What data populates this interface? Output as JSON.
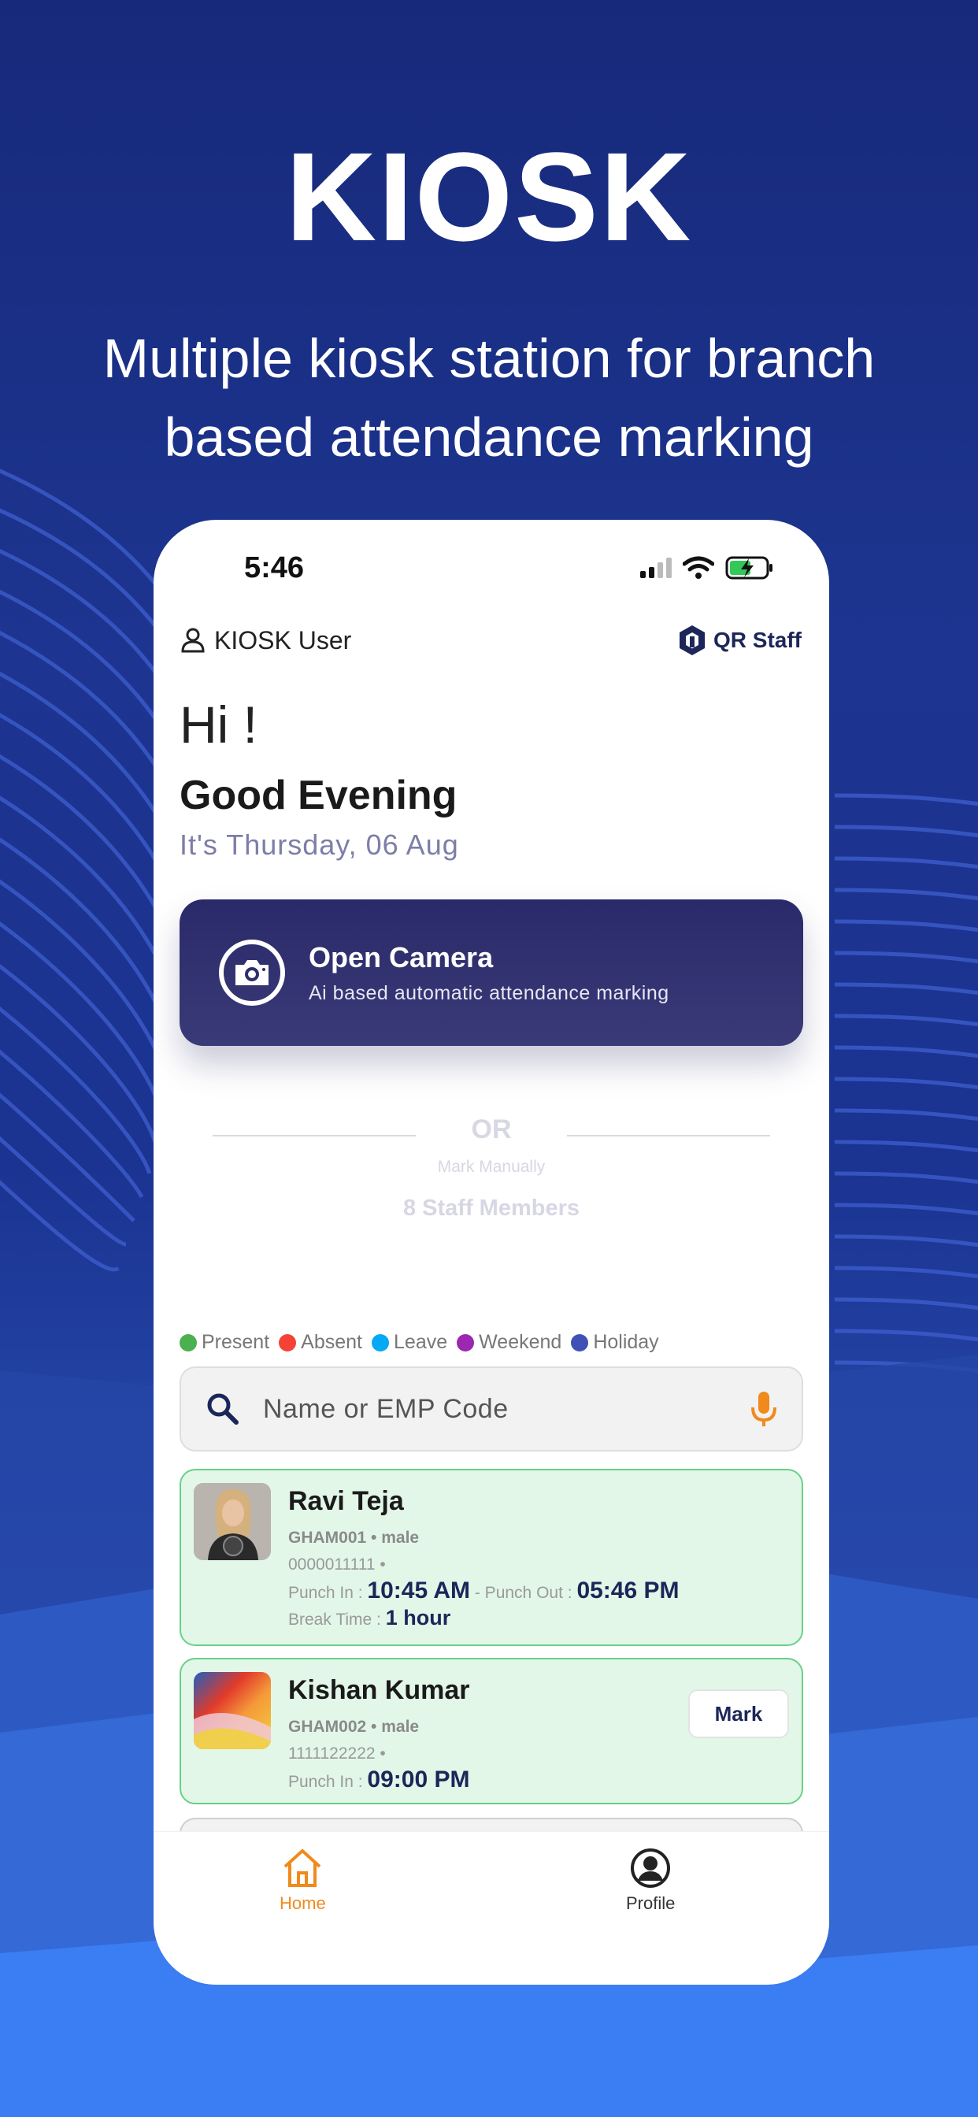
{
  "hero": {
    "title": "KIOSK",
    "subtitle_line1": "Multiple kiosk station for branch",
    "subtitle_line2": "based attendance marking"
  },
  "status_bar": {
    "time": "5:46"
  },
  "header": {
    "user_label": "KIOSK User",
    "brand": "QR Staff"
  },
  "greeting": {
    "hi": "Hi !",
    "message": "Good Evening",
    "date": "It's Thursday, 06 Aug"
  },
  "camera_card": {
    "title": "Open Camera",
    "subtitle": "Ai based automatic attendance marking"
  },
  "divider": {
    "or": "OR",
    "mark_manually": "Mark Manually",
    "staff_count": "8 Staff Members"
  },
  "legend": [
    {
      "label": "Present",
      "color": "#4caf50"
    },
    {
      "label": "Absent",
      "color": "#f44336"
    },
    {
      "label": "Leave",
      "color": "#03a9f4"
    },
    {
      "label": "Weekend",
      "color": "#9c27b0"
    },
    {
      "label": "Holiday",
      "color": "#3f51b5"
    }
  ],
  "search": {
    "placeholder": "Name or EMP Code"
  },
  "employees": [
    {
      "name": "Ravi Teja",
      "code_gender": "GHAM001 • male",
      "phone": "0000011111 •",
      "punch_in_label": "Punch In :",
      "punch_in": "10:45 AM",
      "punch_out_label": "- Punch Out :",
      "punch_out": "05:46 PM",
      "break_label": "Break Time :",
      "break_time": "1 hour"
    },
    {
      "name": "Kishan Kumar",
      "code_gender": "GHAM002 • male",
      "phone": "1111122222 •",
      "punch_in_label": "Punch In :",
      "punch_in": "09:00 PM",
      "action": "Mark"
    }
  ],
  "tabs": [
    {
      "label": "Home",
      "active": true,
      "icon": "home-icon"
    },
    {
      "label": "Profile",
      "active": false,
      "icon": "profile-icon"
    }
  ],
  "colors": {
    "accent_orange": "#f08a1c",
    "navy": "#1c2659",
    "present_bg": "#e2f7e8"
  }
}
